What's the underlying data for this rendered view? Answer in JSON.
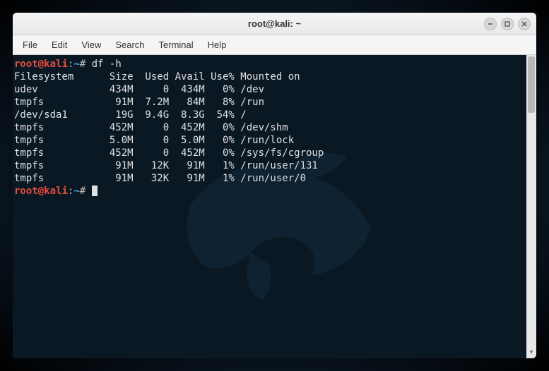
{
  "window": {
    "title": "root@kali: ~"
  },
  "menu": {
    "file": "File",
    "edit": "Edit",
    "view": "View",
    "search": "Search",
    "terminal": "Terminal",
    "help": "Help"
  },
  "prompt": {
    "user": "root",
    "at": "@",
    "host": "kali",
    "sep": ":",
    "path": "~",
    "hash": "#"
  },
  "command": "df -h",
  "output": {
    "header": "Filesystem      Size  Used Avail Use% Mounted on",
    "rows": [
      "udev            434M     0  434M   0% /dev",
      "tmpfs            91M  7.2M   84M   8% /run",
      "/dev/sda1        19G  9.4G  8.3G  54% /",
      "tmpfs           452M     0  452M   0% /dev/shm",
      "tmpfs           5.0M     0  5.0M   0% /run/lock",
      "tmpfs           452M     0  452M   0% /sys/fs/cgroup",
      "tmpfs            91M   12K   91M   1% /run/user/131",
      "tmpfs            91M   32K   91M   1% /run/user/0"
    ]
  },
  "chart_data": {
    "type": "table",
    "title": "df -h output",
    "columns": [
      "Filesystem",
      "Size",
      "Used",
      "Avail",
      "Use%",
      "Mounted on"
    ],
    "rows": [
      [
        "udev",
        "434M",
        "0",
        "434M",
        "0%",
        "/dev"
      ],
      [
        "tmpfs",
        "91M",
        "7.2M",
        "84M",
        "8%",
        "/run"
      ],
      [
        "/dev/sda1",
        "19G",
        "9.4G",
        "8.3G",
        "54%",
        "/"
      ],
      [
        "tmpfs",
        "452M",
        "0",
        "452M",
        "0%",
        "/dev/shm"
      ],
      [
        "tmpfs",
        "5.0M",
        "0",
        "5.0M",
        "0%",
        "/run/lock"
      ],
      [
        "tmpfs",
        "452M",
        "0",
        "452M",
        "0%",
        "/sys/fs/cgroup"
      ],
      [
        "tmpfs",
        "91M",
        "12K",
        "91M",
        "1%",
        "/run/user/131"
      ],
      [
        "tmpfs",
        "91M",
        "32K",
        "91M",
        "1%",
        "/run/user/0"
      ]
    ]
  }
}
